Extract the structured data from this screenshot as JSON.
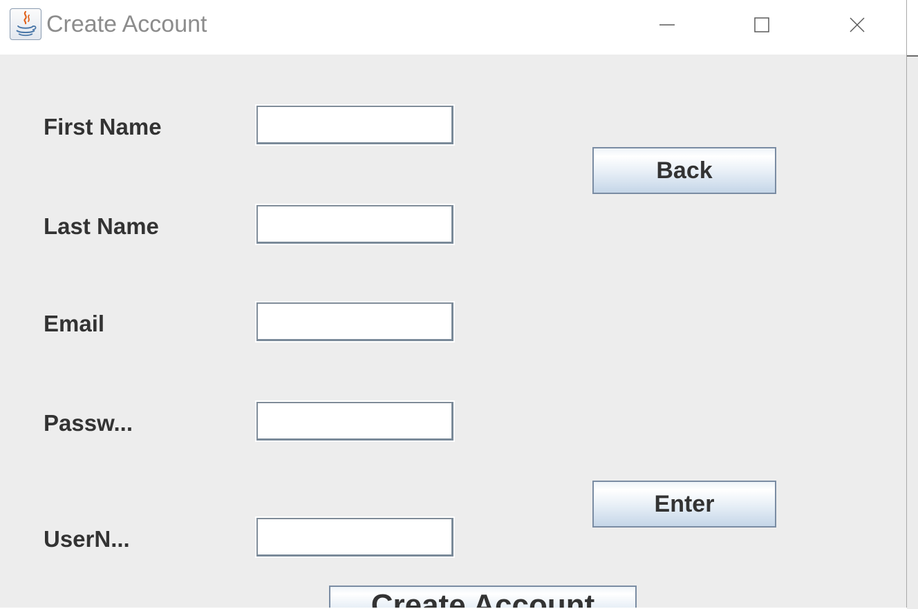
{
  "window": {
    "title": "Create Account",
    "icon": "java-cup-icon",
    "controls": {
      "minimize": "minimize-icon",
      "maximize": "maximize-icon",
      "close": "close-icon"
    }
  },
  "form": {
    "fields": [
      {
        "label": "First Name",
        "value": ""
      },
      {
        "label": "Last Name",
        "value": ""
      },
      {
        "label": "Email",
        "value": ""
      },
      {
        "label": "Passw...",
        "value": ""
      },
      {
        "label": "UserN...",
        "value": ""
      }
    ]
  },
  "buttons": {
    "back": "Back",
    "enter": "Enter",
    "partial": "Create Account"
  },
  "colors": {
    "window_bg": "#ededed",
    "titlebar_bg": "#ffffff",
    "title_text": "#8c8c8c",
    "label_text": "#333333",
    "button_border": "#7a8ca3",
    "field_border": "#7f8c99"
  }
}
